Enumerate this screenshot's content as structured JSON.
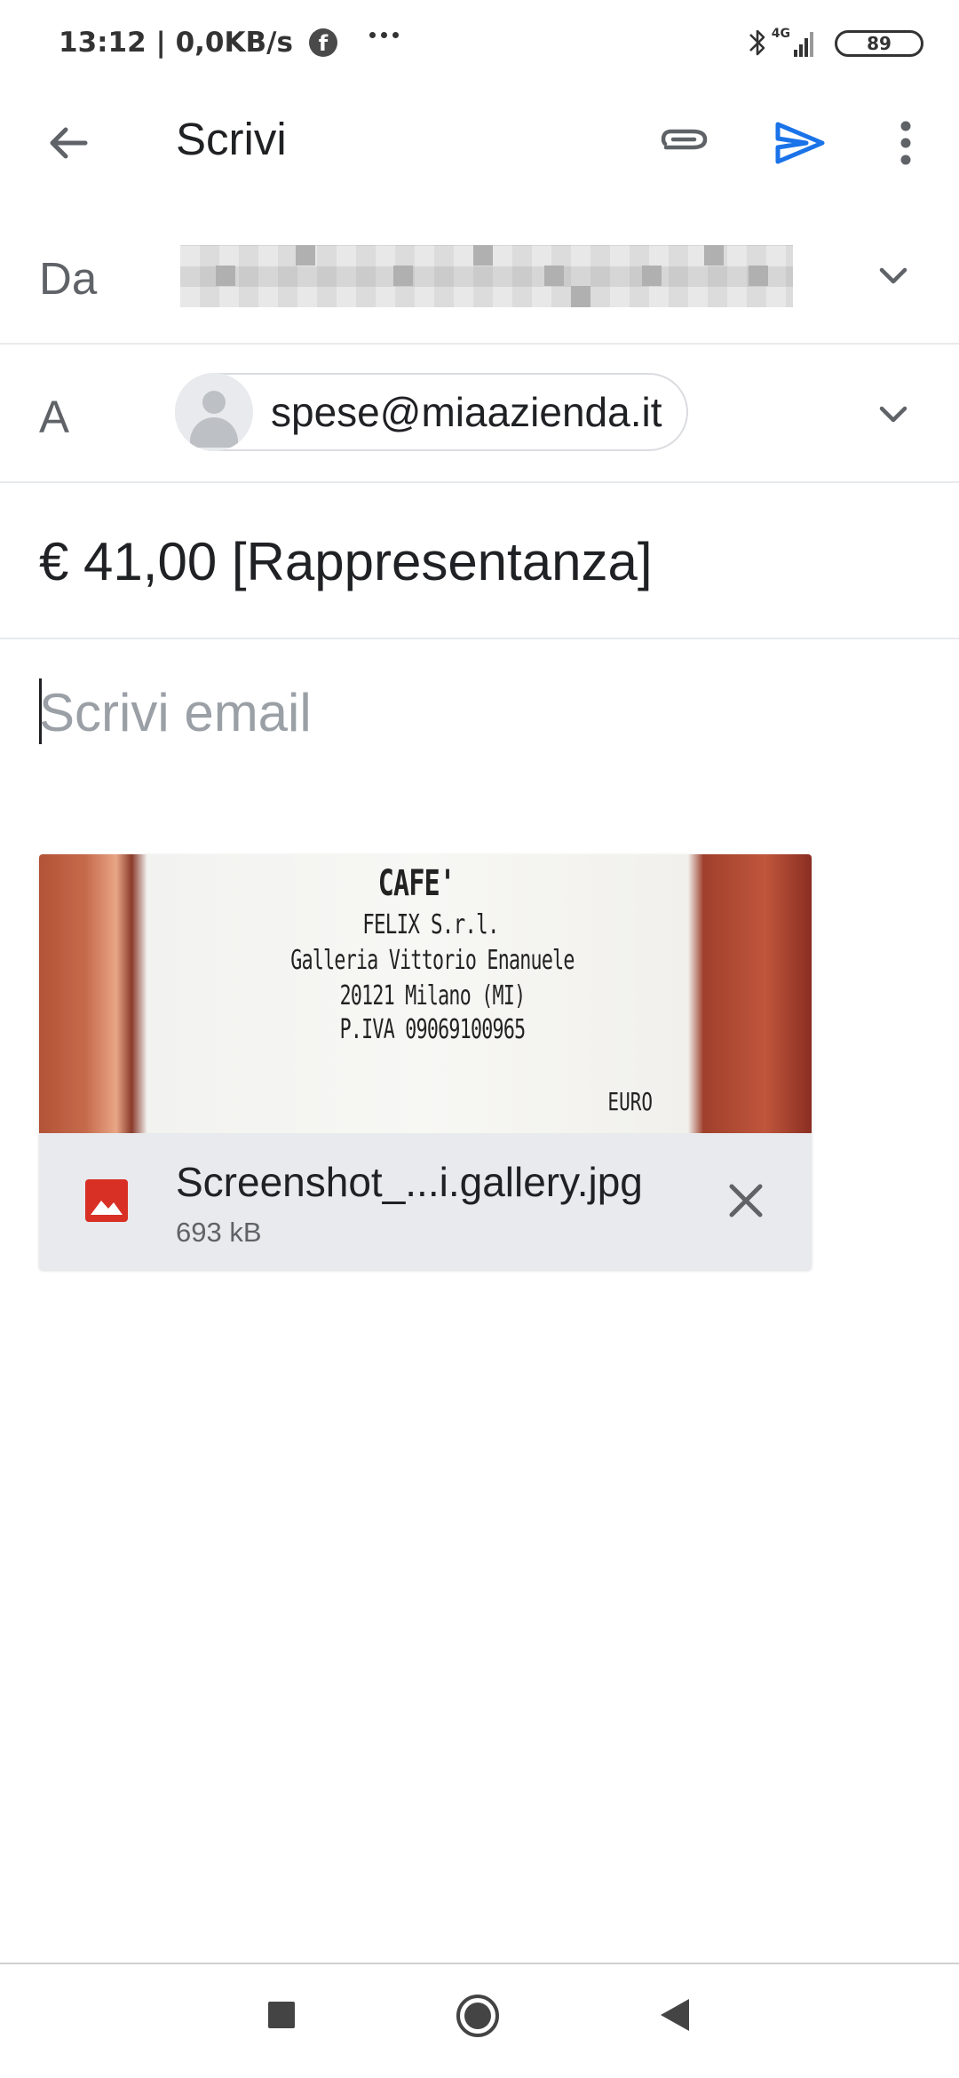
{
  "status_bar": {
    "time": "13:12 | 0,0KB/s",
    "network": "4G",
    "battery": "89",
    "icons": [
      "facebook-icon",
      "more-dots-icon",
      "bluetooth-icon",
      "signal-icon",
      "battery-icon"
    ]
  },
  "app_bar": {
    "title": "Scrivi",
    "icons": [
      "arrow-back-icon",
      "paperclip-icon",
      "send-icon",
      "more-vert-icon"
    ],
    "accent_color": "#1a73e8"
  },
  "compose": {
    "from_label": "Da",
    "to_label": "A",
    "to_recipient": "spese@miaazienda.it",
    "subject": "€ 41,00 [Rappresentanza]",
    "body_placeholder": "Scrivi email"
  },
  "attachment": {
    "preview_lines": [
      "CAFE'",
      "FELIX S.r.l.",
      "Galleria Vittorio Enanuele",
      "20121 Milano (MI)",
      "P.IVA 09069100965",
      "EURO"
    ],
    "file_name": "Screenshot_...i.gallery.jpg",
    "file_size": "693 kB",
    "type_icon": "image-file-icon",
    "type_color": "#d93025"
  },
  "nav_bar": {
    "icons": [
      "recents-square-icon",
      "home-circle-icon",
      "back-triangle-icon"
    ]
  }
}
